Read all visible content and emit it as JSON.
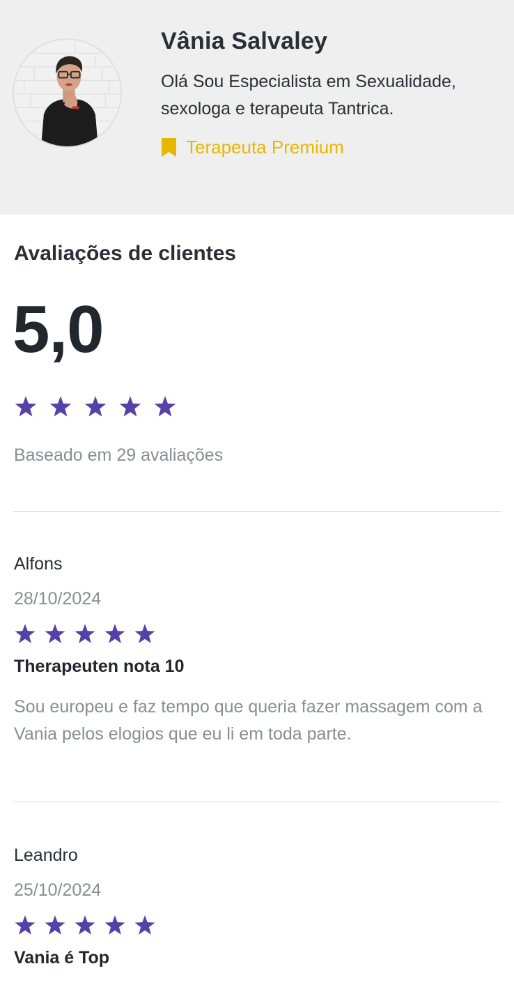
{
  "therapist": {
    "name": "Vânia Salvaley",
    "bio": "Olá Sou Especialista em Sexualidade, sexologa e terapeuta Tantrica.",
    "badge_label": "Terapeuta Premium",
    "badge_icon": "bookmark-icon",
    "badge_color": "#e6b800"
  },
  "ratings": {
    "section_title": "Avaliações de clientes",
    "score": "5,0",
    "stars": 5,
    "max_stars": 5,
    "based_on": "Baseado em 29 avaliações",
    "star_color": "#5641a8"
  },
  "reviews": [
    {
      "author": "Alfons",
      "date": "28/10/2024",
      "stars": 5,
      "title": "Therapeuten nota 10",
      "body": "Sou europeu e faz tempo que queria fazer massagem com a Vania pelos elogios que eu li em toda parte."
    },
    {
      "author": "Leandro",
      "date": "25/10/2024",
      "stars": 5,
      "title": "Vania é Top",
      "body": ""
    }
  ]
}
